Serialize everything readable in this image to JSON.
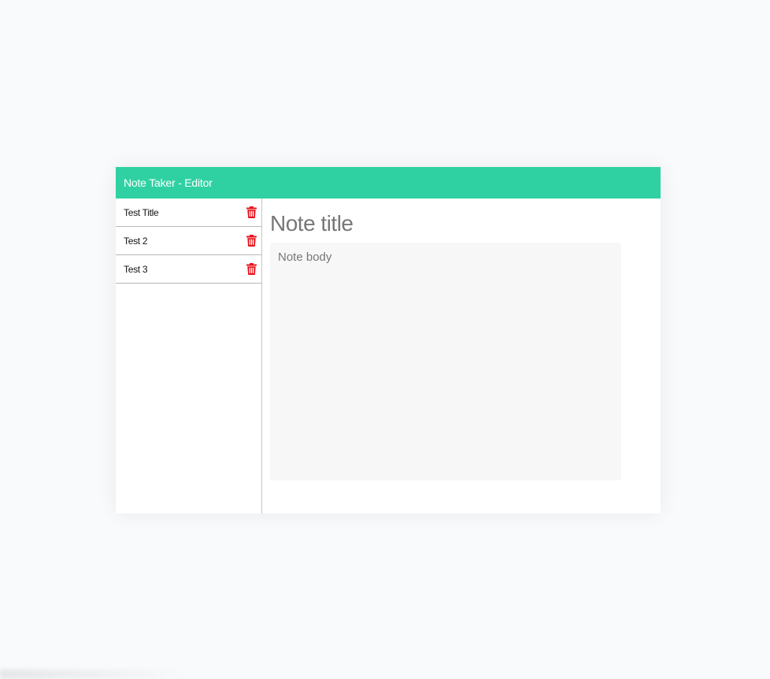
{
  "header": {
    "title": "Note Taker - Editor"
  },
  "notes": [
    {
      "title": "Test Title",
      "delete_icon": "trash-icon"
    },
    {
      "title": "Test 2",
      "delete_icon": "trash-icon"
    },
    {
      "title": "Test 3",
      "delete_icon": "trash-icon"
    }
  ],
  "editor": {
    "title_placeholder": "Note title",
    "body_placeholder": "Note body"
  },
  "colors": {
    "header": "#2fd1a3",
    "delete": "#e8131c"
  }
}
